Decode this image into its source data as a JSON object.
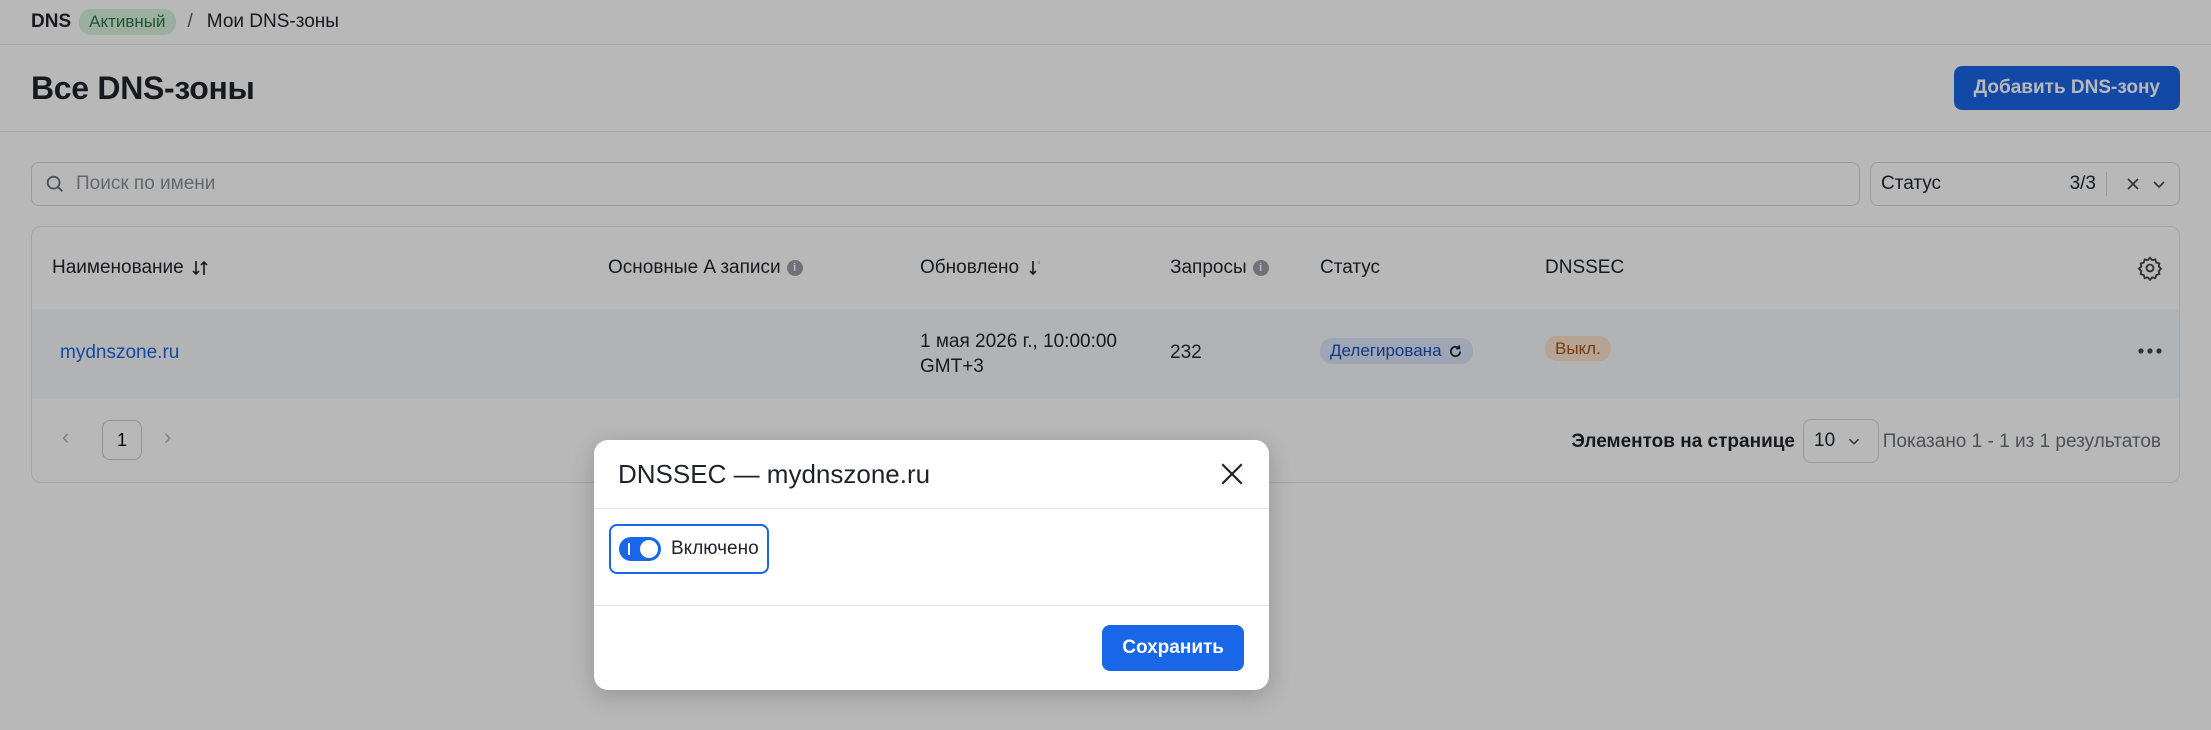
{
  "breadcrumb": {
    "service": "DNS",
    "service_status": "Активный",
    "separator": "/",
    "current": "Мои DNS-зоны"
  },
  "page": {
    "title": "Все DNS-зоны",
    "add_button": "Добавить DNS-зону"
  },
  "search": {
    "placeholder": "Поиск по имени",
    "value": ""
  },
  "status_filter": {
    "label": "Статус",
    "count": "3/3"
  },
  "table": {
    "headers": {
      "name": "Наименование",
      "a_records": "Основные A записи",
      "updated": "Обновлено",
      "requests": "Запросы",
      "status": "Статус",
      "dnssec": "DNSSEC"
    },
    "rows": [
      {
        "name": "mydnszone.ru",
        "a_records": "",
        "updated_line1": "1 мая 2026 г., 10:00:00",
        "updated_line2": "GMT+3",
        "requests": "232",
        "status": "Делегирована",
        "dnssec": "Выкл."
      }
    ]
  },
  "pagination": {
    "current_page": "1",
    "per_page_label": "Элементов на странице",
    "per_page_value": "10",
    "results": "Показано 1 - 1 из 1 результатов"
  },
  "modal": {
    "title": "DNSSEC — mydnszone.ru",
    "toggle_label": "Включено",
    "toggle_on": true,
    "save_button": "Сохранить"
  },
  "colors": {
    "primary": "#1a66e8",
    "active_badge": "#d9f0df",
    "delegated_badge": "#dbe7fb",
    "off_badge": "#fbe3cc"
  }
}
